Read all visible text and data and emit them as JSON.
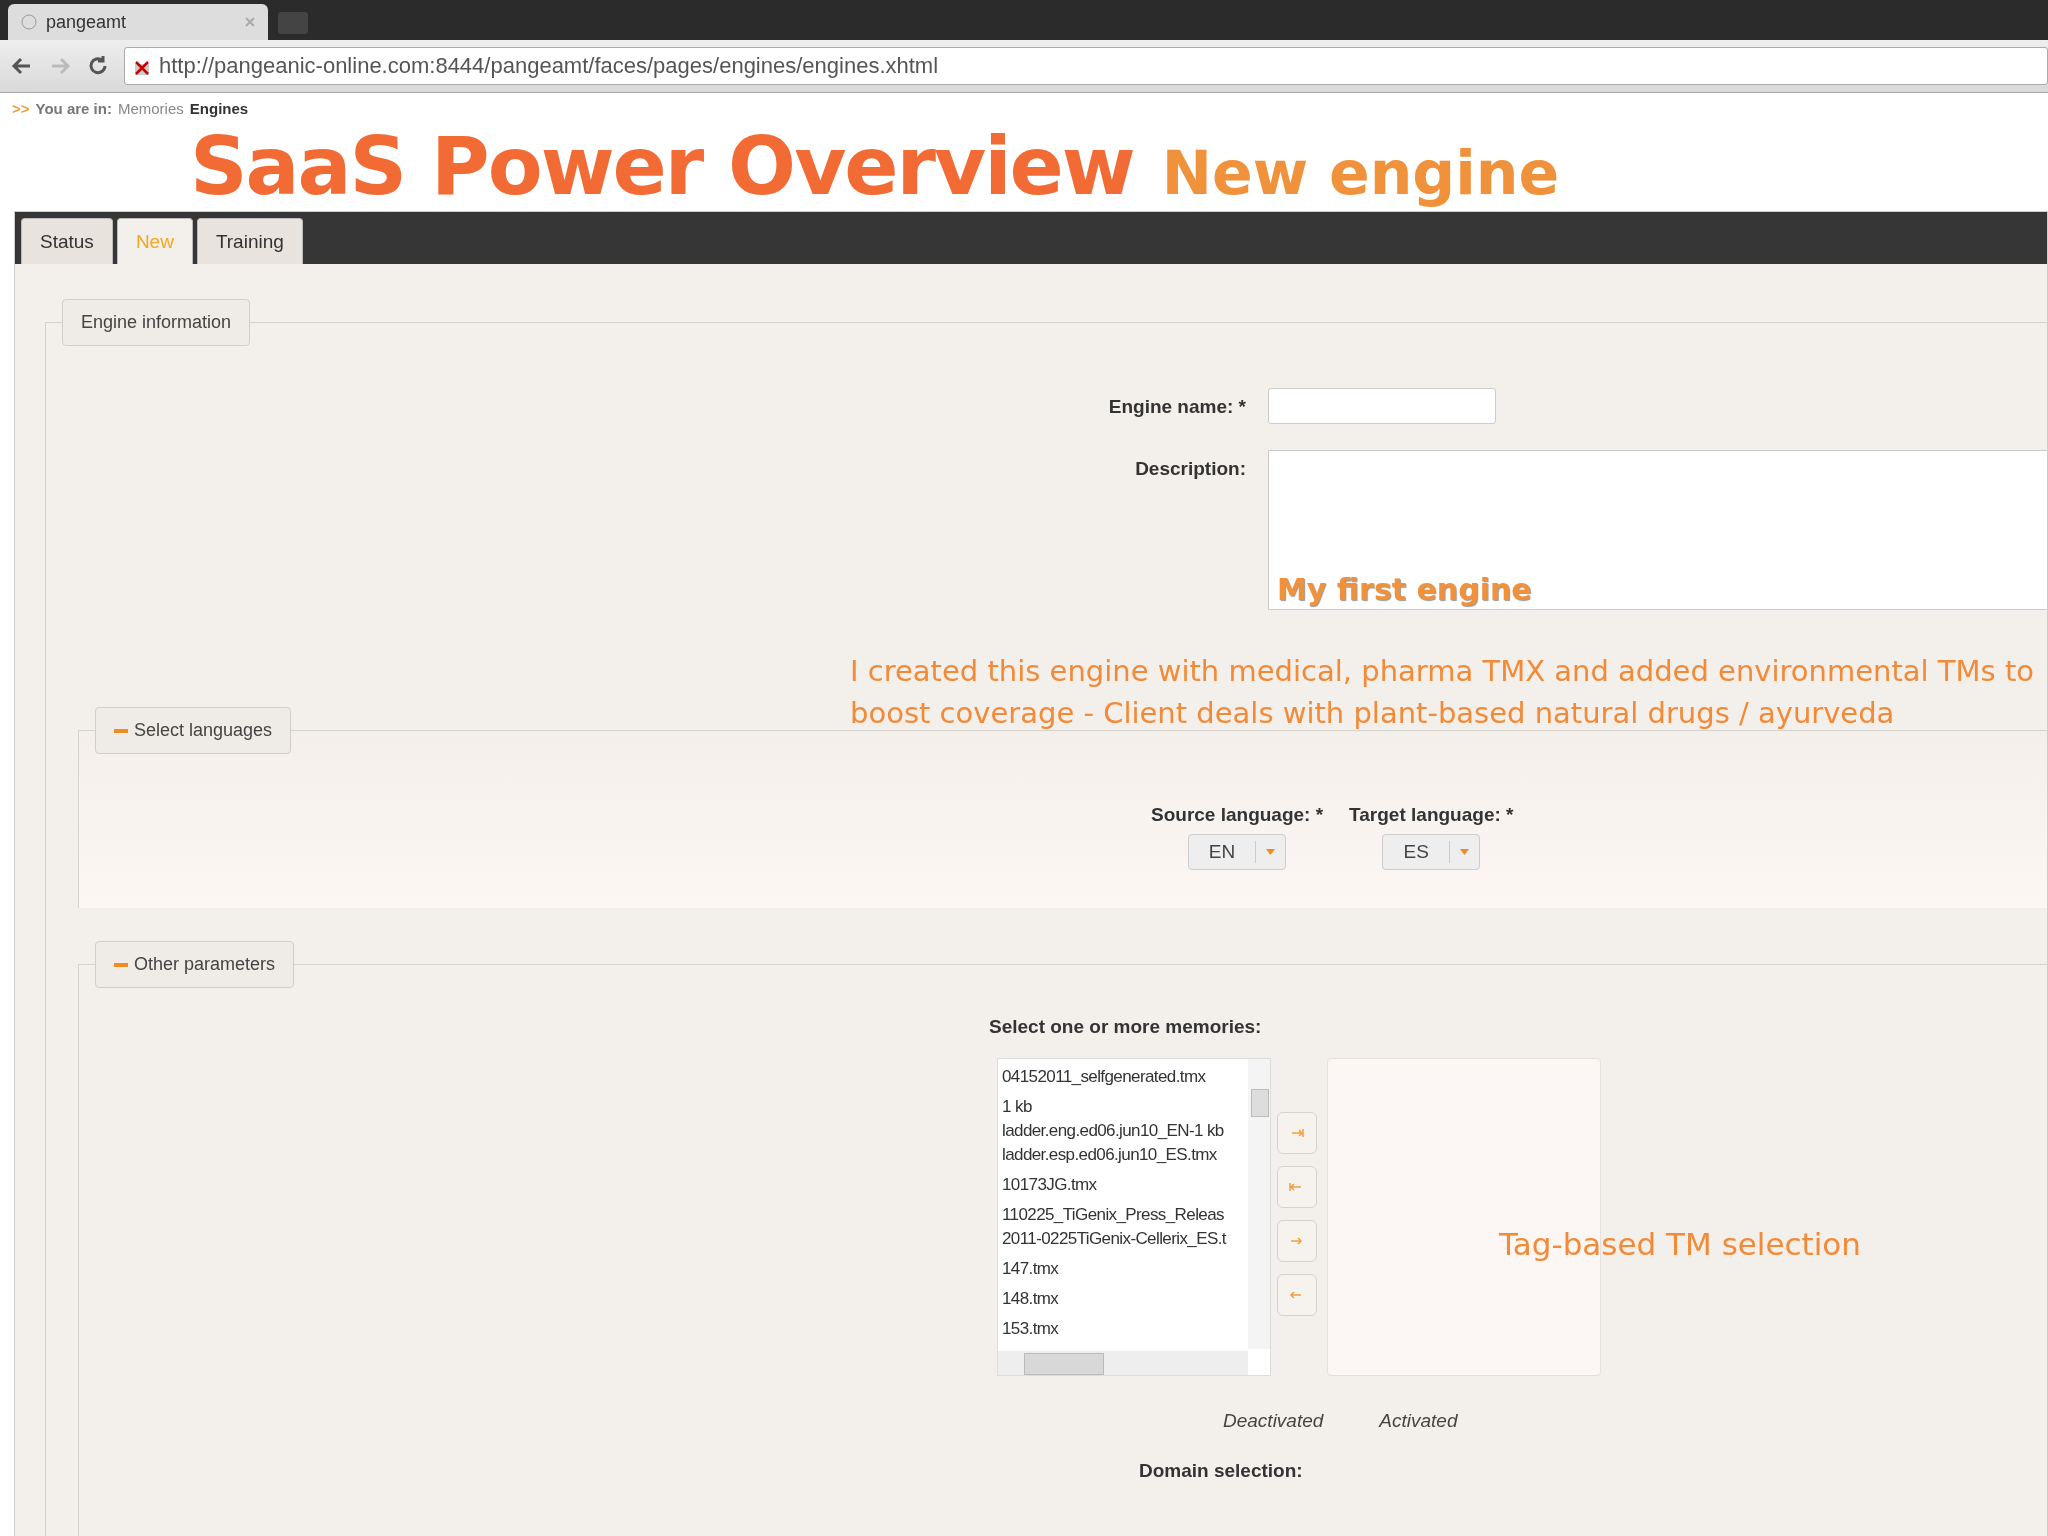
{
  "browser": {
    "tab_title": "pangeamt",
    "url": "http://pangeanic-online.com:8444/pangeamt/faces/pages/engines/engines.xhtml"
  },
  "slide_title": {
    "main": "SaaS Power Overview",
    "sub": "New engine"
  },
  "breadcrumb": {
    "prefix": ">>",
    "label": "You are in:",
    "items": [
      "Memories",
      "Engines"
    ]
  },
  "tabs": [
    {
      "label": "Status",
      "selected": false
    },
    {
      "label": "New",
      "selected": true
    },
    {
      "label": "Training",
      "selected": false
    }
  ],
  "engine_information": {
    "legend": "Engine information",
    "name_label": "Engine name: *",
    "description_label": "Description:",
    "description_note": "My first engine"
  },
  "annotation": "I created this engine with medical, pharma TMX and added environmental TMs to boost coverage - Client deals with plant-based natural drugs / ayurveda",
  "select_languages": {
    "legend": "Select languages",
    "expanded": true,
    "source_label": "Source language: *",
    "source_value": "EN",
    "target_label": "Target language: *",
    "target_value": "ES"
  },
  "other_parameters": {
    "legend": "Other parameters",
    "expanded": true,
    "memories_label": "Select one or more memories:",
    "deactivated_items": [
      [
        "04152011_selfgenerated.tmx"
      ],
      [
        "1 kb",
        "ladder.eng.ed06.jun10_EN-1 kb",
        "ladder.esp.ed06.jun10_ES.tmx"
      ],
      [
        "10173JG.tmx"
      ],
      [
        "110225_TiGenix_Press_Releas",
        "2011-0225TiGenix-Cellerix_ES.t"
      ],
      [
        "147.tmx"
      ],
      [
        "148.tmx"
      ],
      [
        "153.tmx"
      ]
    ],
    "activated_note": "Tag-based TM selection",
    "deactivated_caption": "Deactivated",
    "activated_caption": "Activated",
    "domain_label": "Domain selection:"
  }
}
